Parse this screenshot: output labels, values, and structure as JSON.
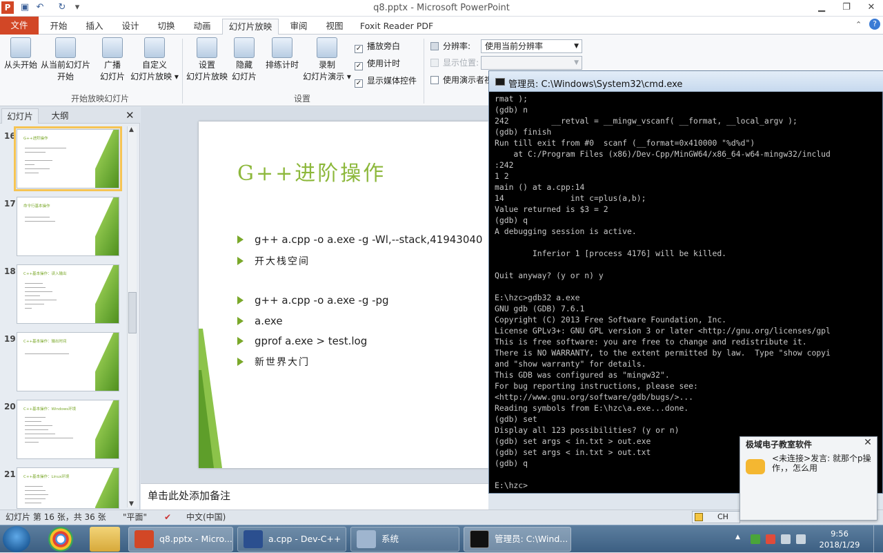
{
  "titlebar": {
    "title": "q8.pptx - Microsoft PowerPoint",
    "app_logo": "P",
    "qat_icons": [
      "save-icon",
      "undo-icon",
      "redo-icon",
      "customize-icon"
    ]
  },
  "ribbon_tabs": [
    "文件",
    "开始",
    "插入",
    "设计",
    "切换",
    "动画",
    "幻灯片放映",
    "审阅",
    "视图",
    "Foxit Reader PDF"
  ],
  "ribbon": {
    "from_start": "从头开始",
    "from_current_1": "从当前幻灯片",
    "from_current_2": "开始",
    "broadcast_1": "广播",
    "broadcast_2": "幻灯片",
    "custom_1": "自定义",
    "custom_2": "幻灯片放映",
    "group_start_show": "开始放映幻灯片",
    "setup_1": "设置",
    "setup_2": "幻灯片放映",
    "hide_1": "隐藏",
    "hide_2": "幻灯片",
    "rehearse": "排练计时",
    "record_1": "录制",
    "record_2": "幻灯片演示",
    "chk_narration": "播放旁白",
    "chk_timings": "使用计时",
    "chk_media": "显示媒体控件",
    "group_setup": "设置",
    "resolution_label": "分辨率:",
    "resolution_value": "使用当前分辨率",
    "show_on_label": "显示位置:",
    "presenter_view": "使用演示者视"
  },
  "left_pane": {
    "tab_slides": "幻灯片",
    "tab_outline": "大纲",
    "thumbnails": [
      {
        "num": "16",
        "title": "G++进阶操作"
      },
      {
        "num": "17",
        "title": "命令行基本操作"
      },
      {
        "num": "18",
        "title": "C++基本操作：读入输出"
      },
      {
        "num": "19",
        "title": "C++基本操作：输出时间"
      },
      {
        "num": "20",
        "title": "C++基本操作：Windows环境"
      },
      {
        "num": "21",
        "title": "C++基本操作：Linux环境"
      }
    ]
  },
  "slide": {
    "title": "G++进阶操作",
    "bullets": [
      "g++ a.cpp -o a.exe -g -Wl,--stack,41943040",
      "开大栈空间",
      "g++ a.cpp -o a.exe -g -pg",
      "a.exe",
      "gprof a.exe > test.log",
      "新世界大门"
    ]
  },
  "notes_placeholder": "单击此处添加备注",
  "statusbar": {
    "slide_pos": "幻灯片 第 16 张，共 36 张",
    "theme": "\"平面\"",
    "language": "中文(中国)"
  },
  "cmd": {
    "title": "管理员: C:\\Windows\\System32\\cmd.exe",
    "lines": [
      "rmat );",
      "(gdb) n",
      "242         __retval = __mingw_vscanf( __format, __local_argv );",
      "(gdb) finish",
      "Run till exit from #0  scanf (__format=0x410000 \"%d%d\")",
      "    at C:/Program Files (x86)/Dev-Cpp/MinGW64/x86_64-w64-mingw32/includ",
      ":242",
      "1 2",
      "main () at a.cpp:14",
      "14              int c=plus(a,b);",
      "Value returned is $3 = 2",
      "(gdb) q",
      "A debugging session is active.",
      "",
      "        Inferior 1 [process 4176] will be killed.",
      "",
      "Quit anyway? (y or n) y",
      "",
      "E:\\hzc>gdb32 a.exe",
      "GNU gdb (GDB) 7.6.1",
      "Copyright (C) 2013 Free Software Foundation, Inc.",
      "License GPLv3+: GNU GPL version 3 or later <http://gnu.org/licenses/gpl",
      "This is free software: you are free to change and redistribute it.",
      "There is NO WARRANTY, to the extent permitted by law.  Type \"show copyi",
      "and \"show warranty\" for details.",
      "This GDB was configured as \"mingw32\".",
      "For bug reporting instructions, please see:",
      "<http://www.gnu.org/software/gdb/bugs/>...",
      "Reading symbols from E:\\hzc\\a.exe...done.",
      "(gdb) set",
      "Display all 123 possibilities? (y or n)",
      "(gdb) set args < in.txt > out.exe",
      "(gdb) set args < in.txt > out.txt",
      "(gdb) q",
      "",
      "E:\\hzc>"
    ]
  },
  "popup": {
    "title": "极域电子教室软件",
    "message": "<未连接>发言: 就那个p操作，，怎么用"
  },
  "langbar": {
    "text": "CH"
  },
  "taskbar": {
    "tasks": [
      {
        "label": "q8.pptx - Micro..."
      },
      {
        "label": "a.cpp - Dev-C++"
      },
      {
        "label": "系统"
      },
      {
        "label": "管理员: C:\\Wind..."
      }
    ],
    "time": "9:56",
    "date": "2018/1/29"
  },
  "colors": {
    "file_tab": "#d24726",
    "slide_accent": "#8db83c",
    "thumb_selected": "#f6c453"
  }
}
